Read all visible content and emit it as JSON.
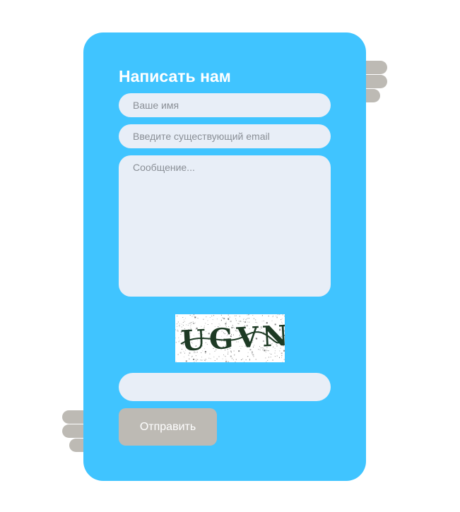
{
  "form": {
    "title": "Написать нам",
    "name_placeholder": "Ваше имя",
    "email_placeholder": "Введите существующий email",
    "message_placeholder": "Сообщение...",
    "captcha_text": "UGVN",
    "captcha_value": "",
    "submit_label": "Отправить"
  },
  "colors": {
    "card_background": "#40c4ff",
    "input_background": "#e8eef7",
    "button_background": "#bdbab4",
    "decoration": "#bdbab4"
  }
}
